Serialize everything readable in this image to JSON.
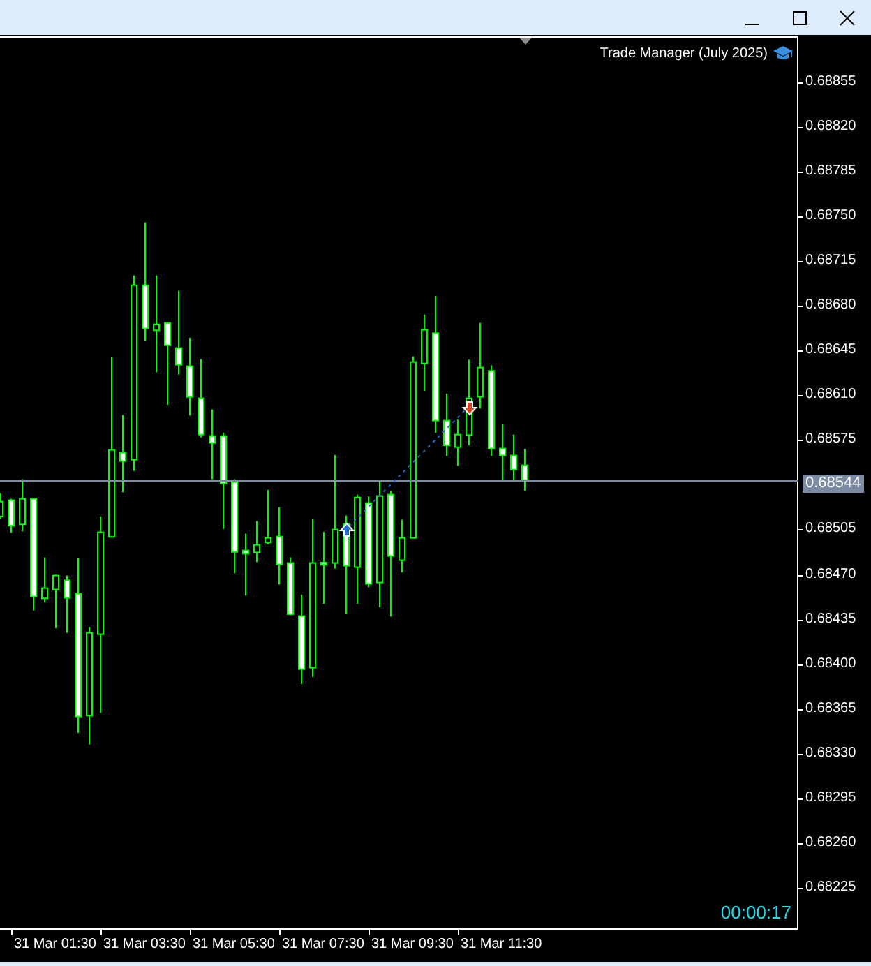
{
  "window": {
    "controls": [
      {
        "kind": "minimize"
      },
      {
        "kind": "maximize"
      },
      {
        "kind": "close"
      }
    ]
  },
  "chart": {
    "indicator_label": "Trade Manager (July 2025)",
    "timer": "00:00:17",
    "current_price": "0.68544",
    "price_axis": [
      "0.68855",
      "0.68820",
      "0.68785",
      "0.68750",
      "0.68715",
      "0.68680",
      "0.68645",
      "0.68610",
      "0.68575",
      "0.68505",
      "0.68470",
      "0.68435",
      "0.68400",
      "0.68365",
      "0.68330",
      "0.68295",
      "0.68260",
      "0.68225"
    ],
    "time_axis": [
      "31 Mar 01:30",
      "31 Mar 03:30",
      "31 Mar 05:30",
      "31 Mar 07:30",
      "31 Mar 09:30",
      "31 Mar 11:30"
    ]
  }
}
